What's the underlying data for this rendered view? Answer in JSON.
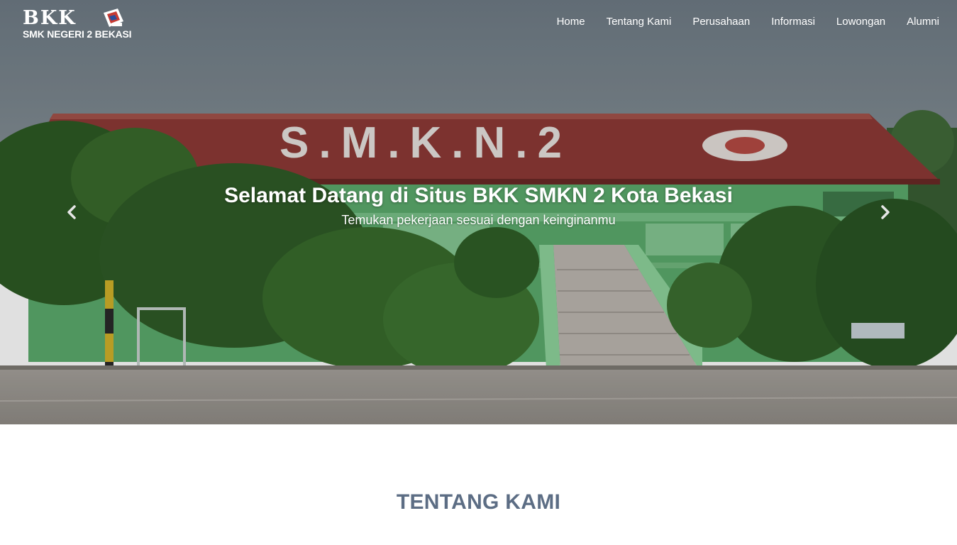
{
  "brand": {
    "title": "BKK",
    "subtitle": "SMK NEGERI 2 BEKASI",
    "emblem_icon": "school-emblem-icon"
  },
  "nav": {
    "items": [
      {
        "label": "Home"
      },
      {
        "label": "Tentang Kami"
      },
      {
        "label": "Perusahaan"
      },
      {
        "label": "Informasi"
      },
      {
        "label": "Lowongan"
      },
      {
        "label": "Alumni"
      }
    ]
  },
  "hero": {
    "heading": "Selamat Datang di Situs BKK SMKN 2 Kota Bekasi",
    "subheading": "Temukan pekerjaan sesuai dengan keinginanmu",
    "roof_lettering": "S.M.K.N.2",
    "prev_icon": "chevron-left-icon",
    "next_icon": "chevron-right-icon"
  },
  "about": {
    "heading": "TENTANG KAMI"
  },
  "colors": {
    "sky": "#7f8a91",
    "roof": "#8e3a36",
    "wall": "#5cab6d",
    "foliage": "#2f5a25",
    "ground": "#9a9690",
    "section_heading": "#5c6d84",
    "nav_text": "#ffffff"
  }
}
